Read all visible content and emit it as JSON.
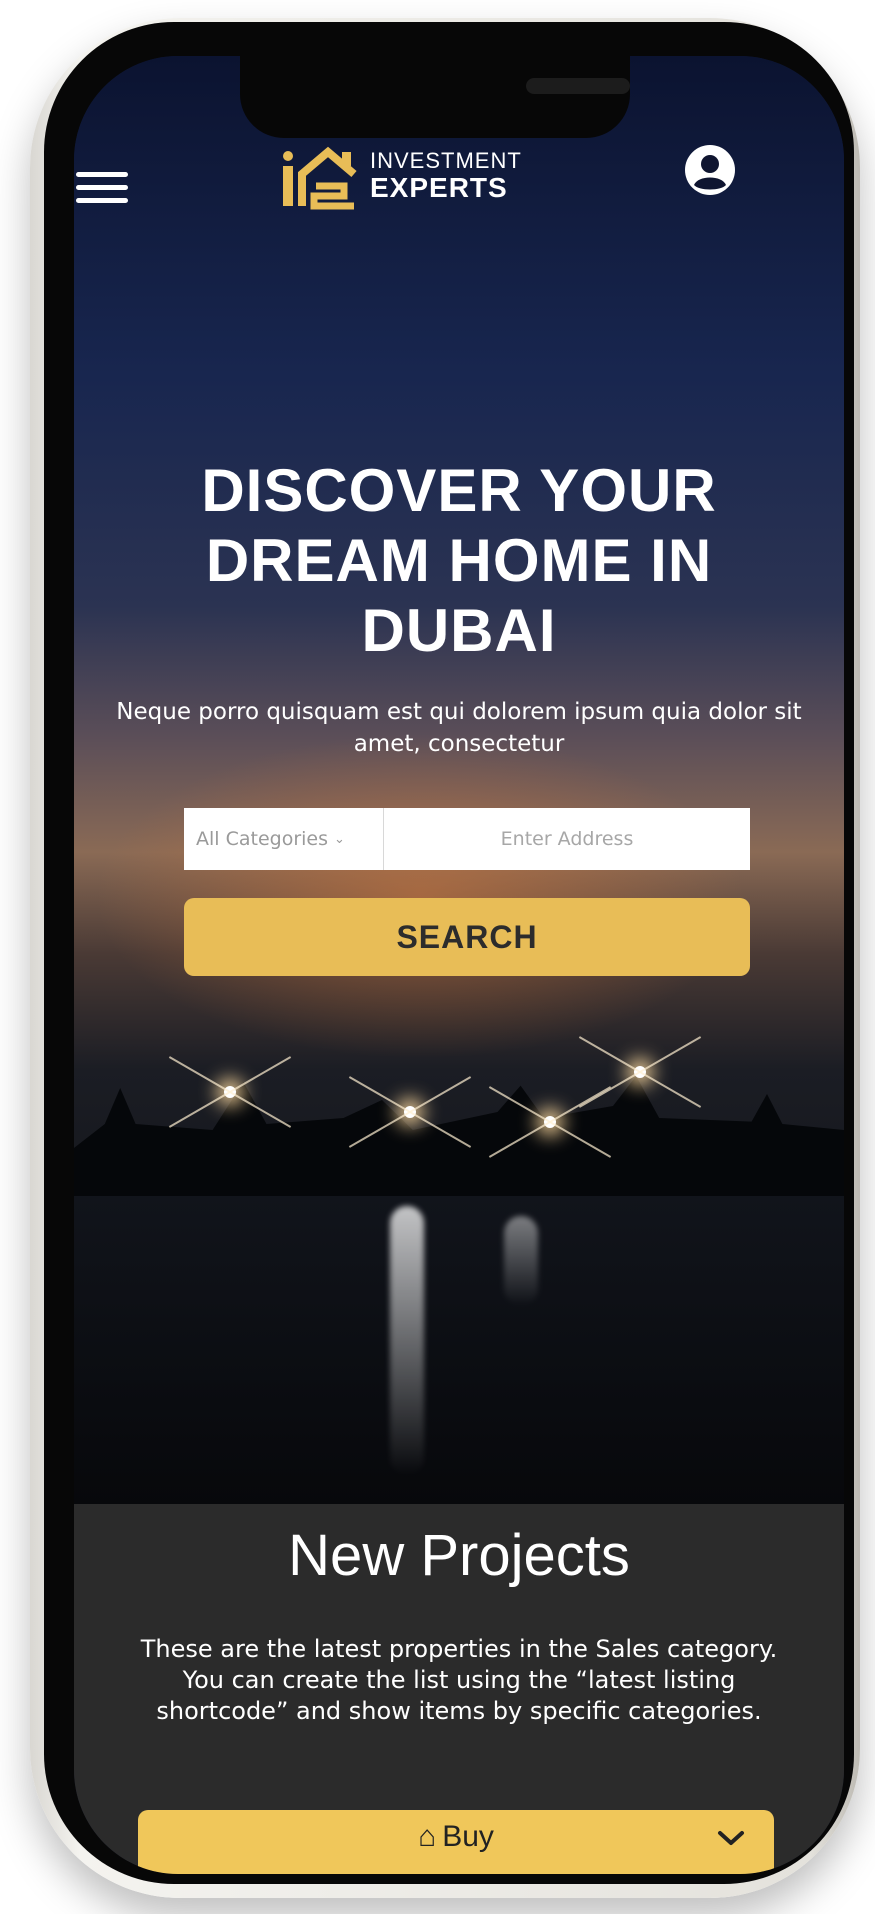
{
  "header": {
    "logo_line1": "INVESTMENT",
    "logo_line2": "EXPERTS",
    "icons": {
      "menu": "hamburger-menu-icon",
      "account": "user-circle-icon"
    }
  },
  "hero": {
    "headline": "DISCOVER YOUR DREAM HOME IN DUBAI",
    "subtitle": "Neque porro quisquam est qui dolorem ipsum quia dolor sit amet, consectetur",
    "search": {
      "category_selected": "All Categories",
      "address_placeholder": "Enter Address",
      "button_label": "SEARCH"
    }
  },
  "projects": {
    "title": "New Projects",
    "description": "These are the latest properties in the Sales category. You can create the list using the “latest listing shortcode” and show items by specific categories.",
    "dropdown_label": "Buy"
  },
  "colors": {
    "accent_gold": "#e8bd57",
    "dropdown_gold": "#f0c75a",
    "section_dark": "#2b2b2b"
  }
}
